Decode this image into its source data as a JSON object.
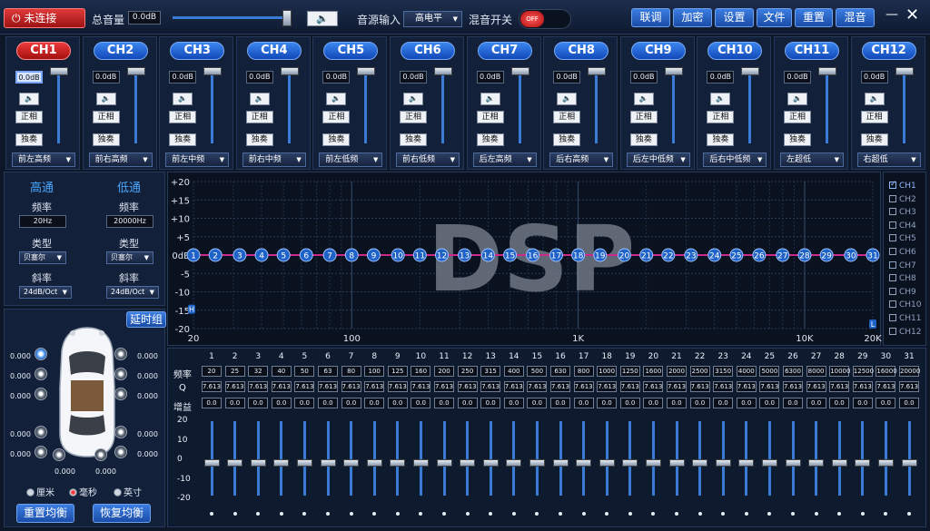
{
  "topbar": {
    "connect_label": "未连接",
    "volume_label": "总音量",
    "volume_value": "0.0dB",
    "volume_level_pct": 100,
    "source_label": "音源输入",
    "source_value": "高电平",
    "mix_label": "混音开关",
    "mix_state": "OFF",
    "menu": [
      "联调",
      "加密",
      "设置",
      "文件",
      "重置",
      "混音"
    ],
    "minimize": "—",
    "close": "✕"
  },
  "channels": [
    {
      "name": "CH1",
      "gain": "0.0dB",
      "phase": "正相",
      "solo": "独奏",
      "pos": "前左高频",
      "active": true
    },
    {
      "name": "CH2",
      "gain": "0.0dB",
      "phase": "正相",
      "solo": "独奏",
      "pos": "前右高频"
    },
    {
      "name": "CH3",
      "gain": "0.0dB",
      "phase": "正相",
      "solo": "独奏",
      "pos": "前左中频"
    },
    {
      "name": "CH4",
      "gain": "0.0dB",
      "phase": "正相",
      "solo": "独奏",
      "pos": "前右中频"
    },
    {
      "name": "CH5",
      "gain": "0.0dB",
      "phase": "正相",
      "solo": "独奏",
      "pos": "前左低频"
    },
    {
      "name": "CH6",
      "gain": "0.0dB",
      "phase": "正相",
      "solo": "独奏",
      "pos": "前右低频"
    },
    {
      "name": "CH7",
      "gain": "0.0dB",
      "phase": "正相",
      "solo": "独奏",
      "pos": "后左高频"
    },
    {
      "name": "CH8",
      "gain": "0.0dB",
      "phase": "正相",
      "solo": "独奏",
      "pos": "后右高频"
    },
    {
      "name": "CH9",
      "gain": "0.0dB",
      "phase": "正相",
      "solo": "独奏",
      "pos": "后左中低频"
    },
    {
      "name": "CH10",
      "gain": "0.0dB",
      "phase": "正相",
      "solo": "独奏",
      "pos": "后右中低频"
    },
    {
      "name": "CH11",
      "gain": "0.0dB",
      "phase": "正相",
      "solo": "独奏",
      "pos": "左超低"
    },
    {
      "name": "CH12",
      "gain": "0.0dB",
      "phase": "正相",
      "solo": "独奏",
      "pos": "右超低"
    }
  ],
  "filter": {
    "highpass_title": "高通",
    "lowpass_title": "低通",
    "freq_label": "频率",
    "type_label": "类型",
    "slope_label": "斜率",
    "hp_freq": "20Hz",
    "lp_freq": "20000Hz",
    "hp_type": "贝塞尔",
    "lp_type": "贝塞尔",
    "hp_slope": "24dB/Oct",
    "lp_slope": "24dB/Oct"
  },
  "delay": {
    "title": "延时组",
    "values": [
      "0.000",
      "0.000",
      "0.000",
      "0.000",
      "0.000",
      "0.000",
      "0.000",
      "0.000",
      "0.000",
      "0.000",
      "0.000",
      "0.000"
    ],
    "units": [
      "厘米",
      "毫秒",
      "英寸"
    ],
    "selected_unit": "毫秒",
    "reset_label": "重置均衡",
    "restore_label": "恢复均衡"
  },
  "graph": {
    "watermark": "DSP",
    "y_ticks": [
      "+20",
      "+15",
      "+10",
      "+5",
      "0dB",
      "-5",
      "-10",
      "-15",
      "-20"
    ],
    "x_ticks": [
      "20",
      "100",
      "1K",
      "10K",
      "20K"
    ],
    "hp_marker": "H",
    "lp_marker": "L",
    "legend": [
      "CH1",
      "CH2",
      "CH3",
      "CH4",
      "CH5",
      "CH6",
      "CH7",
      "CH8",
      "CH9",
      "CH10",
      "CH11",
      "CH12"
    ],
    "legend_checked": [
      "CH1"
    ],
    "curve_color": "#cc2a8a",
    "accent": "#1f63c9"
  },
  "eq": {
    "row_freq": "频率",
    "row_q": "Q",
    "row_gain": "增益",
    "scale": [
      "20",
      "10",
      "0",
      "-10",
      "-20"
    ],
    "bands": [
      "1",
      "2",
      "3",
      "4",
      "5",
      "6",
      "7",
      "8",
      "9",
      "10",
      "11",
      "12",
      "13",
      "14",
      "15",
      "16",
      "17",
      "18",
      "19",
      "20",
      "21",
      "22",
      "23",
      "24",
      "25",
      "26",
      "27",
      "28",
      "29",
      "30",
      "31"
    ],
    "freqs": [
      "20",
      "25",
      "32",
      "40",
      "50",
      "63",
      "80",
      "100",
      "125",
      "160",
      "200",
      "250",
      "315",
      "400",
      "500",
      "630",
      "800",
      "1000",
      "1250",
      "1600",
      "2000",
      "2500",
      "3150",
      "4000",
      "5000",
      "6300",
      "8000",
      "10000",
      "12500",
      "16000",
      "20000"
    ],
    "q": "7.613",
    "gains": [
      "0.0",
      "0.0",
      "0.0",
      "0.0",
      "0.0",
      "0.0",
      "0.0",
      "0.0",
      "0.0",
      "0.0",
      "0.0",
      "0.0",
      "0.0",
      "0.0",
      "0.0",
      "0.0",
      "0.0",
      "0.0",
      "0.0",
      "0.0",
      "0.0",
      "0.0",
      "0.0",
      "0.0",
      "0.0",
      "0.0",
      "0.0",
      "0.0",
      "0.0",
      "0.0",
      "0.0"
    ]
  }
}
